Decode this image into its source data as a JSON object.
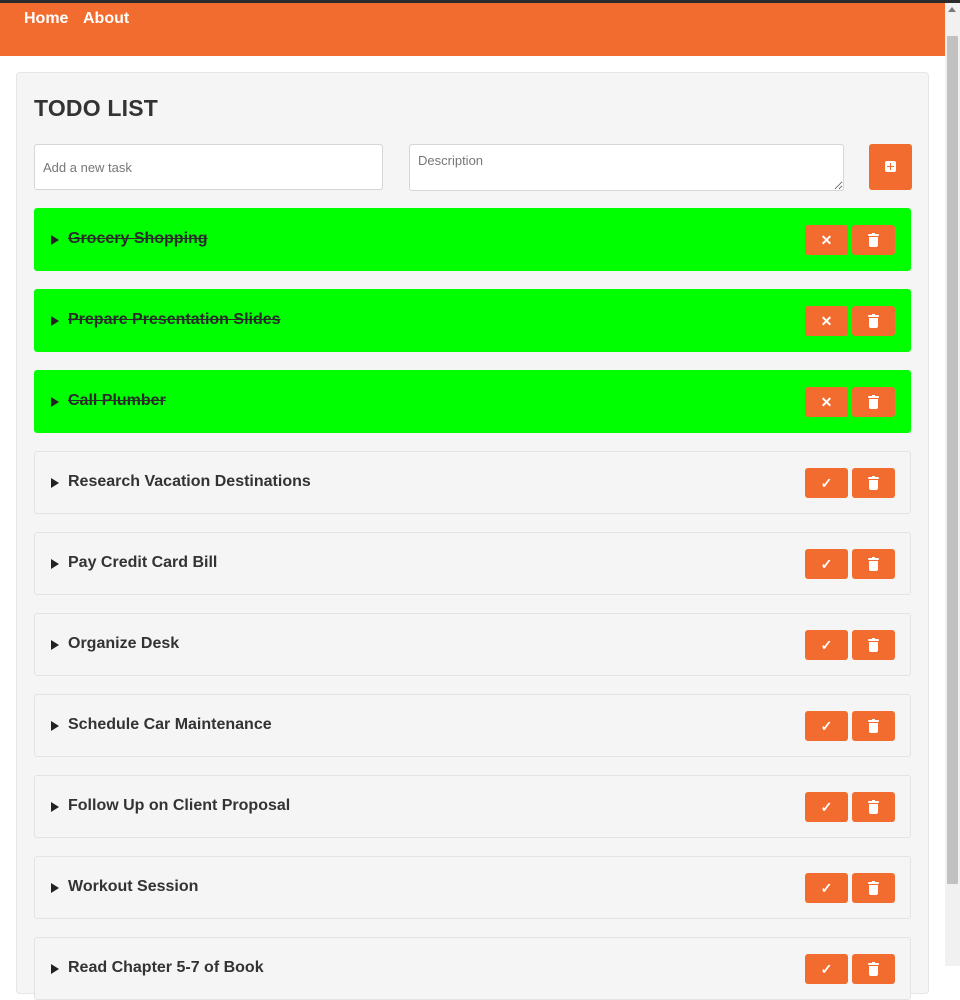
{
  "nav": {
    "home": "Home",
    "about": "About"
  },
  "page": {
    "title": "TODO LIST"
  },
  "form": {
    "task_placeholder": "Add a new task",
    "description_placeholder": "Description",
    "add_icon": "plus-square-icon"
  },
  "colors": {
    "accent": "#f26c2f",
    "completed": "#00ff00"
  },
  "icons": {
    "toggle_done": "xmark-icon",
    "toggle_open": "check-icon",
    "delete": "trash-icon"
  },
  "tasks": [
    {
      "title": "Grocery Shopping",
      "completed": true
    },
    {
      "title": "Prepare Presentation Slides",
      "completed": true
    },
    {
      "title": "Call Plumber",
      "completed": true
    },
    {
      "title": "Research Vacation Destinations",
      "completed": false
    },
    {
      "title": "Pay Credit Card Bill",
      "completed": false
    },
    {
      "title": "Organize Desk",
      "completed": false
    },
    {
      "title": "Schedule Car Maintenance",
      "completed": false
    },
    {
      "title": "Follow Up on Client Proposal",
      "completed": false
    },
    {
      "title": "Workout Session",
      "completed": false
    },
    {
      "title": "Read Chapter 5-7 of Book",
      "completed": false
    }
  ]
}
